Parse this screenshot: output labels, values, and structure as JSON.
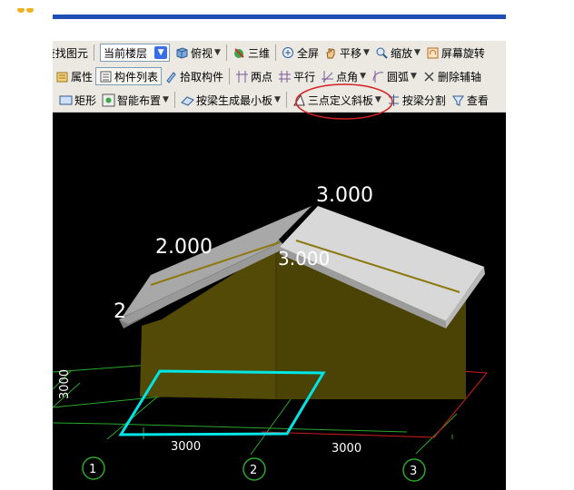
{
  "toolbar1": {
    "find_label": "查找图元",
    "floor_select_value": "当前楼层",
    "top_view_label": "俯视",
    "three_d_label": "三维",
    "fullscreen_label": "全屏",
    "pan_label": "平移",
    "zoom_label": "缩放",
    "screen_rotate_label": "屏幕旋转"
  },
  "toolbar2": {
    "properties_label": "属性",
    "component_list_label": "构件列表",
    "pick_component_label": "拾取构件",
    "two_points_label": "两点",
    "parallel_label": "平行",
    "point_angle_label": "点角",
    "arc_label": "圆弧",
    "delete_aux_label": "删除辅轴"
  },
  "toolbar3": {
    "rectangle_label": "矩形",
    "smart_layout_label": "智能布置",
    "beam_min_slab_label": "按梁生成最小板",
    "three_point_slope_label": "三点定义斜板",
    "beam_split_label": "按梁分割",
    "view_label": "查看"
  },
  "viewport": {
    "elev_top": "3.000",
    "elev_left": "2.000",
    "elev_middle": "3.000",
    "elev_bottom_left": "2",
    "dim_vertical": "3000",
    "dim_x1": "3000",
    "dim_x2": "3000",
    "axis_1": "1",
    "axis_2": "2",
    "axis_3": "3"
  },
  "colors": {
    "roof_light": "#d8d8d8",
    "roof_dark": "#a6a6a6",
    "wall": "#524a06",
    "highlight_slab": "#00e5e5",
    "grid_green": "#2aa82a",
    "grid_red": "#d01c1c",
    "annotation_circle": "#d42020"
  }
}
